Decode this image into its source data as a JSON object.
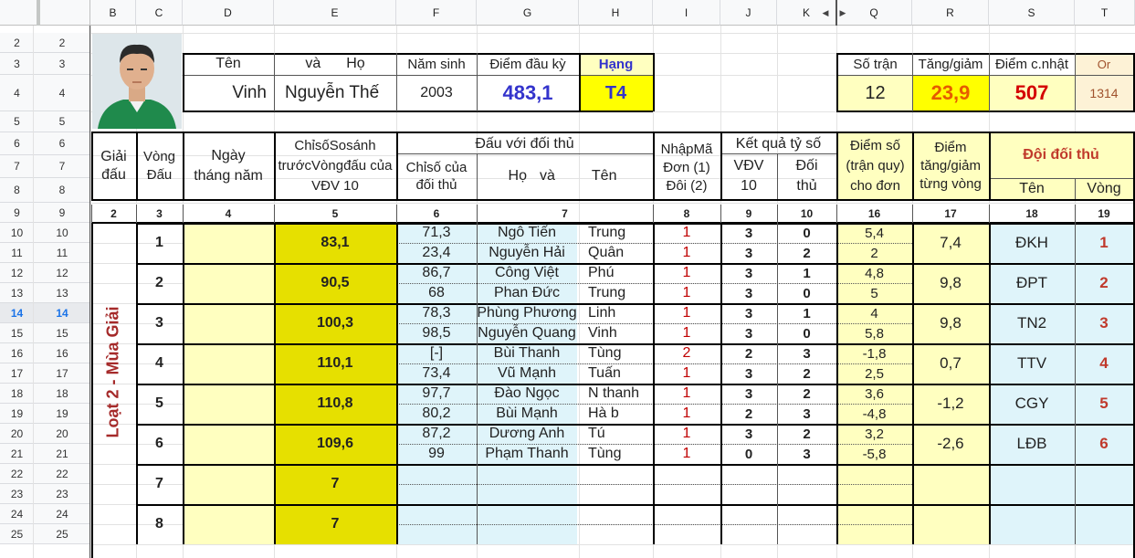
{
  "columns": [
    "B",
    "C",
    "D",
    "E",
    "F",
    "G",
    "H",
    "I",
    "J",
    "K",
    "Q",
    "R",
    "S",
    "T"
  ],
  "row_numbers": [
    {
      "a": "2",
      "b": "2"
    },
    {
      "a": "3",
      "b": "3"
    },
    {
      "a": "4",
      "b": "4"
    },
    {
      "a": "5",
      "b": "5"
    },
    {
      "a": "6",
      "b": "6"
    },
    {
      "a": "7",
      "b": "7"
    },
    {
      "a": "8",
      "b": "8"
    },
    {
      "a": "9",
      "b": "9"
    },
    {
      "a": "10",
      "b": "10"
    },
    {
      "a": "11",
      "b": "11"
    },
    {
      "a": "12",
      "b": "12"
    },
    {
      "a": "13",
      "b": "13"
    },
    {
      "a": "14",
      "b": "14"
    },
    {
      "a": "15",
      "b": "15"
    },
    {
      "a": "16",
      "b": "16"
    },
    {
      "a": "17",
      "b": "17"
    },
    {
      "a": "18",
      "b": "18"
    },
    {
      "a": "19",
      "b": "19"
    },
    {
      "a": "20",
      "b": "20"
    },
    {
      "a": "21",
      "b": "21"
    },
    {
      "a": "22",
      "b": "22"
    },
    {
      "a": "23",
      "b": "23"
    },
    {
      "a": "24",
      "b": "24"
    },
    {
      "a": "25",
      "b": "25"
    }
  ],
  "selected_row": "14",
  "player": {
    "hdr_ten": "Tên",
    "hdr_va": "và",
    "hdr_ho": "Họ",
    "first_name": "Vinh",
    "last_name": "Nguyễn Thế",
    "hdr_namsinh": "Năm sinh",
    "birth_year": "2003",
    "hdr_diem": "Điểm đầu kỳ",
    "start_points": "483,1",
    "hdr_hang": "Hạng",
    "rank": "T4"
  },
  "summary": {
    "hdr_sotran": "Số trận",
    "matches": "12",
    "hdr_tanggiam": "Tăng/giảm",
    "change": "23,9",
    "hdr_diemcn": "Điểm c.nhật",
    "updated": "507",
    "hdr_or": "Or",
    "or_value": "1314"
  },
  "headers": {
    "giai": "Giải đấu",
    "vong": "Vòng Đấu",
    "ngay": "Ngày tháng năm",
    "chiso": "ChỉsốSosánh trướcVòngđấu của VĐV 10",
    "dauvoi": "Đấu với đối thủ",
    "chiso_dt": "Chỉsố của đối thủ",
    "ho": "Họ",
    "va": "và",
    "ten": "Tên",
    "nhapma": "NhậpMã Đơn (1) Đôi (2)",
    "ketqua": "Kết quả tỷ số",
    "vdv": "VĐV 10",
    "doithu": "Đối thủ",
    "diemso": "Điểm số (trận quy) cho đơn",
    "diemtg": "Điểm tăng/giảm từng vòng",
    "doidt": "Đội đối thủ",
    "ten2": "Tên",
    "vong2": "Vòng"
  },
  "index_row": [
    "2",
    "3",
    "4",
    "5",
    "6",
    "7",
    "8",
    "9",
    "10",
    "16",
    "17",
    "18",
    "19"
  ],
  "season_label": "Loạt 2 - Mùa Giải",
  "rounds": [
    {
      "round": "1",
      "index": "83,1",
      "change": "7,4",
      "team": "ĐKH",
      "team_round": "1",
      "opponents": [
        {
          "idx": "71,3",
          "ho": "Ngô Tiến",
          "ten": "Trung",
          "code": "1",
          "s1": "3",
          "s2": "0",
          "pts": "5,4"
        },
        {
          "idx": "23,4",
          "ho": "Nguyễn Hải",
          "ten": "Quân",
          "code": "1",
          "s1": "3",
          "s2": "2",
          "pts": "2"
        }
      ]
    },
    {
      "round": "2",
      "index": "90,5",
      "change": "9,8",
      "team": "ĐPT",
      "team_round": "2",
      "opponents": [
        {
          "idx": "86,7",
          "ho": "Công Việt",
          "ten": "Phú",
          "code": "1",
          "s1": "3",
          "s2": "1",
          "pts": "4,8"
        },
        {
          "idx": "68",
          "ho": "Phan Đức",
          "ten": "Trung",
          "code": "1",
          "s1": "3",
          "s2": "0",
          "pts": "5"
        }
      ]
    },
    {
      "round": "3",
      "index": "100,3",
      "change": "9,8",
      "team": "TN2",
      "team_round": "3",
      "opponents": [
        {
          "idx": "78,3",
          "ho": "Phùng Phương",
          "ten": "Linh",
          "code": "1",
          "s1": "3",
          "s2": "1",
          "pts": "4"
        },
        {
          "idx": "98,5",
          "ho": "Nguyễn Quang",
          "ten": "Vinh",
          "code": "1",
          "s1": "3",
          "s2": "0",
          "pts": "5,8"
        }
      ]
    },
    {
      "round": "4",
      "index": "110,1",
      "change": "0,7",
      "team": "TTV",
      "team_round": "4",
      "opponents": [
        {
          "idx": "[-]",
          "ho": "Bùi Thanh",
          "ten": "Tùng",
          "code": "2",
          "s1": "2",
          "s2": "3",
          "pts": "-1,8"
        },
        {
          "idx": "73,4",
          "ho": "Vũ Mạnh",
          "ten": "Tuấn",
          "code": "1",
          "s1": "3",
          "s2": "2",
          "pts": "2,5"
        }
      ]
    },
    {
      "round": "5",
      "index": "110,8",
      "change": "-1,2",
      "team": "CGY",
      "team_round": "5",
      "opponents": [
        {
          "idx": "97,7",
          "ho": "Đào Ngọc",
          "ten": "N thanh",
          "code": "1",
          "s1": "3",
          "s2": "2",
          "pts": "3,6"
        },
        {
          "idx": "80,2",
          "ho": "Bùi Mạnh",
          "ten": "Hà b",
          "code": "1",
          "s1": "2",
          "s2": "3",
          "pts": "-4,8"
        }
      ]
    },
    {
      "round": "6",
      "index": "109,6",
      "change": "-2,6",
      "team": "LĐB",
      "team_round": "6",
      "opponents": [
        {
          "idx": "87,2",
          "ho": "Dương Anh",
          "ten": "Tú",
          "code": "1",
          "s1": "3",
          "s2": "2",
          "pts": "3,2"
        },
        {
          "idx": "99",
          "ho": "Phạm Thanh",
          "ten": "Tùng",
          "code": "1",
          "s1": "0",
          "s2": "3",
          "pts": "-5,8"
        }
      ]
    },
    {
      "round": "7",
      "index": "7",
      "change": "",
      "team": "",
      "team_round": "",
      "opponents": []
    },
    {
      "round": "8",
      "index": "7",
      "change": "",
      "team": "",
      "team_round": "",
      "opponents": []
    }
  ],
  "colors": {
    "yellow": "#ffff00",
    "light_yellow": "#ffffc0",
    "olive": "#e6e000",
    "light_blue": "#dff4fa",
    "dark_red": "#a52a2a",
    "blue_value": "#3333cc"
  }
}
